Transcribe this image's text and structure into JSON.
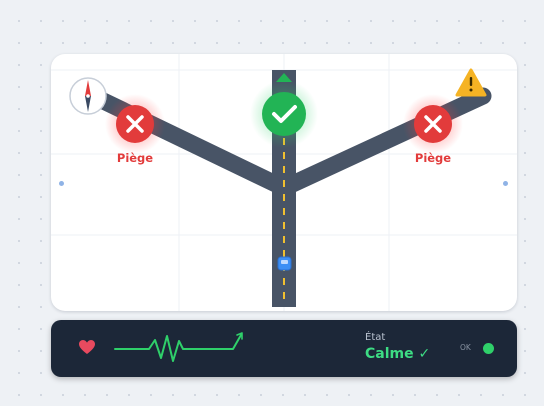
{
  "game": {
    "trap_left_label": "Piège",
    "trap_right_label": "Piège"
  },
  "hud": {
    "state_label": "État",
    "state_value": "Calme ✓",
    "ok_label": "OK"
  },
  "icons": {
    "compass": "compass-icon",
    "warning": "warning-icon",
    "trap": "x-circle-icon",
    "correct": "check-circle-icon",
    "heart": "heart-icon",
    "heartbeat": "heartbeat-line-icon",
    "car": "car-icon",
    "arrow": "arrow-up-icon"
  },
  "colors": {
    "road": "#485466",
    "trap": "#e23b3b",
    "correct": "#22b455",
    "lane_marking": "#f0c030",
    "hud_bg": "#1c2738",
    "heartbeat": "#2fd06a",
    "heart": "#e84a5f",
    "warning": "#f5b324"
  }
}
